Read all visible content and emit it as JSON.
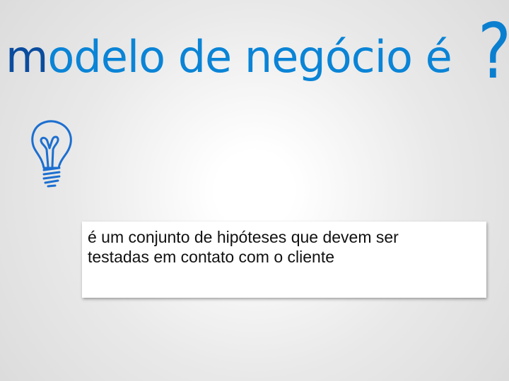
{
  "slide": {
    "title_first_letter": "m",
    "title_rest": "odelo de negócio é",
    "question_mark": "?",
    "definition_line1": "é um conjunto de hipóteses que devem ser",
    "definition_line2": "testadas em contato com o cliente"
  },
  "icons": {
    "bulb": "lightbulb-icon"
  },
  "colors": {
    "title_blue": "#0a84d6",
    "title_first_letter": "#0b4c9e",
    "question_mark": "#0a7fd0",
    "bulb_stroke": "#1c6fd0"
  }
}
